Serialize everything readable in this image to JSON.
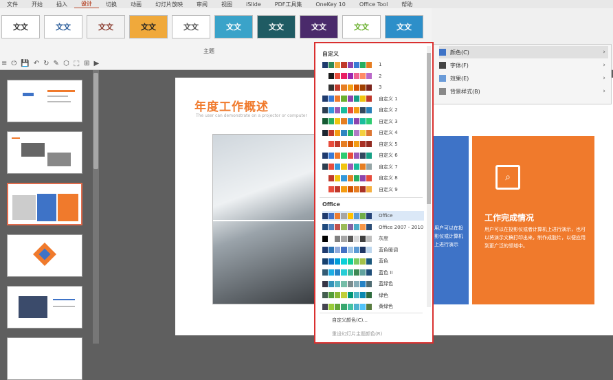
{
  "tabs": [
    "文件",
    "开始",
    "插入",
    "设计",
    "切换",
    "动画",
    "幻灯片放映",
    "审阅",
    "视图",
    "iSlide",
    "PDF工具集",
    "OneKey 10",
    "Office Tool",
    "帮助"
  ],
  "gallery": {
    "swatches": [
      {
        "label": "文文",
        "bg": "#ffffff",
        "fg": "#333333"
      },
      {
        "label": "文文",
        "bg": "#ffffff",
        "fg": "#2a5c9a"
      },
      {
        "label": "文文",
        "bg": "#f2f2f2",
        "fg": "#8a3b2e"
      },
      {
        "label": "文文",
        "bg": "#f0a93b",
        "fg": "#222222"
      },
      {
        "label": "文文",
        "bg": "#ffffff",
        "fg": "#555555"
      },
      {
        "label": "文文",
        "bg": "#3aa3c9",
        "fg": "#ffffff"
      },
      {
        "label": "文文",
        "bg": "#1f5b63",
        "fg": "#ffffff"
      },
      {
        "label": "文文",
        "bg": "#4a2a6b",
        "fg": "#ffffff"
      },
      {
        "label": "文文",
        "bg": "#ffffff",
        "fg": "#6ab02e"
      },
      {
        "label": "文文",
        "bg": "#2d8fc9",
        "fg": "#ffffff"
      }
    ]
  },
  "toolbar": {
    "group_label": "主题",
    "qat": [
      "≡",
      "⏻",
      "💾",
      "↶",
      "↻",
      "✎",
      "⬡",
      "⬚",
      "⊞",
      "▶"
    ]
  },
  "slide": {
    "title": "年度工作概述",
    "subtitle": "The user can demonstrate on a projector or computer",
    "orange_title": "工作完成情况",
    "orange_text": "用户可以在投影仪或者计算机上进行演示，也可以将演示文稿打印出来，制作成胶片，以便应用到更广泛的领域中。",
    "blue_text": "用户可以在投影仪或计算机上进行演示"
  },
  "design_menu": {
    "items": [
      {
        "label": "颜色(C)",
        "icon": "color-grid-icon",
        "highlighted": true
      },
      {
        "label": "字体(F)",
        "icon": "font-icon",
        "highlighted": false
      },
      {
        "label": "效果(E)",
        "icon": "effects-icon",
        "highlighted": false
      },
      {
        "label": "背景样式(B)",
        "icon": "background-icon",
        "highlighted": false
      }
    ]
  },
  "palette": {
    "section_custom": "自定义",
    "section_office": "Office",
    "custom": [
      {
        "name": "1",
        "colors": [
          "#1f3b6e",
          "#2e8b57",
          "#f0a93b",
          "#c0392b",
          "#8e44ad",
          "#3a7bd5",
          "#27ae60",
          "#e67e22"
        ]
      },
      {
        "name": "2",
        "colors": [
          "#ffffff",
          "#1a1a1a",
          "#e74c3c",
          "#e91e63",
          "#9c27b0",
          "#f06292",
          "#ff8a65",
          "#ba68c8"
        ]
      },
      {
        "name": "3",
        "colors": [
          "#ffffff",
          "#333333",
          "#c0392b",
          "#e67e22",
          "#f39c12",
          "#d35400",
          "#a04000",
          "#7b241c"
        ]
      },
      {
        "name": "自定义 1",
        "colors": [
          "#1f3b6e",
          "#3a7bd5",
          "#f07a2c",
          "#6ab02e",
          "#8e44ad",
          "#16a085",
          "#f1c40f",
          "#c0392b"
        ]
      },
      {
        "name": "自定义 2",
        "colors": [
          "#2c3e50",
          "#3498db",
          "#9b59b6",
          "#1abc9c",
          "#e74c3c",
          "#f39c12",
          "#34495e",
          "#2980b9"
        ]
      },
      {
        "name": "自定义 3",
        "colors": [
          "#145a32",
          "#27ae60",
          "#f1c40f",
          "#e67e22",
          "#3498db",
          "#8e44ad",
          "#1abc9c",
          "#2ecc71"
        ]
      },
      {
        "name": "自定义 4",
        "colors": [
          "#1b2631",
          "#c0392b",
          "#f39c12",
          "#2e86c1",
          "#28b463",
          "#af7ac5",
          "#f4d03f",
          "#dc7633"
        ]
      },
      {
        "name": "自定义 5",
        "colors": [
          "#ffffff",
          "#e74c3c",
          "#c0392b",
          "#e67e22",
          "#d35400",
          "#f39c12",
          "#a93226",
          "#922b21"
        ]
      },
      {
        "name": "自定义 6",
        "colors": [
          "#1f3b6e",
          "#3a7bd5",
          "#f07a2c",
          "#2ecc71",
          "#e74c3c",
          "#9b59b6",
          "#34495e",
          "#16a085"
        ]
      },
      {
        "name": "自定义 7",
        "colors": [
          "#2c3e50",
          "#e74c3c",
          "#3498db",
          "#f1c40f",
          "#9b59b6",
          "#1abc9c",
          "#e67e22",
          "#95a5a6"
        ]
      },
      {
        "name": "自定义 8",
        "colors": [
          "#ffffff",
          "#c0392b",
          "#f1c40f",
          "#3498db",
          "#e67e22",
          "#27ae60",
          "#8e44ad",
          "#e74c3c"
        ]
      },
      {
        "name": "自定义 9",
        "colors": [
          "#ffffff",
          "#e74c3c",
          "#c0392b",
          "#f39c12",
          "#d35400",
          "#e67e22",
          "#a93226",
          "#f5b041"
        ]
      }
    ],
    "office": [
      {
        "name": "Office",
        "colors": [
          "#1f3b6e",
          "#4472c4",
          "#ed7d31",
          "#a5a5a5",
          "#ffc000",
          "#5b9bd5",
          "#70ad47",
          "#264478"
        ],
        "selected": true
      },
      {
        "name": "Office 2007 - 2010",
        "colors": [
          "#1f497d",
          "#4f81bd",
          "#c0504d",
          "#9bbb59",
          "#8064a2",
          "#4bacc6",
          "#f79646",
          "#2c4d75"
        ]
      },
      {
        "name": "灰度",
        "colors": [
          "#000000",
          "#ffffff",
          "#808080",
          "#a6a6a6",
          "#595959",
          "#d9d9d9",
          "#404040",
          "#bfbfbf"
        ]
      },
      {
        "name": "蓝色暖调",
        "colors": [
          "#1f3b6e",
          "#2e75b6",
          "#8faadc",
          "#4472c4",
          "#9dc3e6",
          "#5b9bd5",
          "#203864",
          "#bdd7ee"
        ]
      },
      {
        "name": "蓝色",
        "colors": [
          "#17406d",
          "#0f6fc6",
          "#009dd9",
          "#0bd0d9",
          "#10cf9b",
          "#7cca62",
          "#a5c249",
          "#1b587c"
        ]
      },
      {
        "name": "蓝色 II",
        "colors": [
          "#335b74",
          "#1cade4",
          "#2683c6",
          "#27ced7",
          "#42ba97",
          "#3e8853",
          "#62a39f",
          "#1f4e79"
        ]
      },
      {
        "name": "蓝绿色",
        "colors": [
          "#373545",
          "#3494ba",
          "#58b6c0",
          "#75bda7",
          "#7a8c8e",
          "#84acb6",
          "#2683c6",
          "#4e6b72"
        ]
      },
      {
        "name": "绿色",
        "colors": [
          "#455f51",
          "#549e39",
          "#8ab833",
          "#c0cf3a",
          "#029676",
          "#4ab5c4",
          "#0989b1",
          "#2d6b3d"
        ]
      },
      {
        "name": "黄绿色",
        "colors": [
          "#454551",
          "#99cb38",
          "#63a537",
          "#37a76f",
          "#44c1a3",
          "#4eb3cf",
          "#51c3f9",
          "#587b3f"
        ]
      }
    ],
    "footer_customize": "自定义颜色(C)...",
    "footer_reset": "重设幻灯片主题颜色(R)"
  }
}
